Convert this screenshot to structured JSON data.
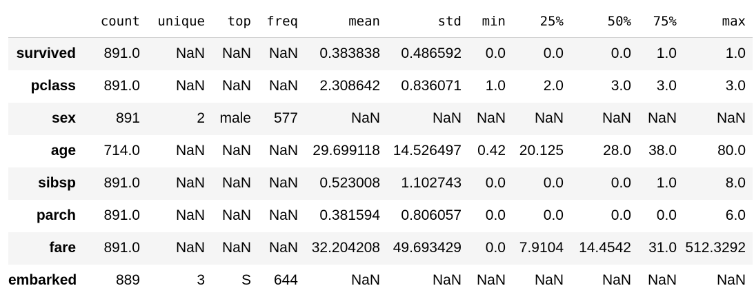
{
  "table": {
    "columns": [
      "count",
      "unique",
      "top",
      "freq",
      "mean",
      "std",
      "min",
      "25%",
      "50%",
      "75%",
      "max"
    ],
    "rows": [
      {
        "label": "survived",
        "cells": [
          "891.0",
          "NaN",
          "NaN",
          "NaN",
          "0.383838",
          "0.486592",
          "0.0",
          "0.0",
          "0.0",
          "1.0",
          "1.0"
        ]
      },
      {
        "label": "pclass",
        "cells": [
          "891.0",
          "NaN",
          "NaN",
          "NaN",
          "2.308642",
          "0.836071",
          "1.0",
          "2.0",
          "3.0",
          "3.0",
          "3.0"
        ]
      },
      {
        "label": "sex",
        "cells": [
          "891",
          "2",
          "male",
          "577",
          "NaN",
          "NaN",
          "NaN",
          "NaN",
          "NaN",
          "NaN",
          "NaN"
        ]
      },
      {
        "label": "age",
        "cells": [
          "714.0",
          "NaN",
          "NaN",
          "NaN",
          "29.699118",
          "14.526497",
          "0.42",
          "20.125",
          "28.0",
          "38.0",
          "80.0"
        ]
      },
      {
        "label": "sibsp",
        "cells": [
          "891.0",
          "NaN",
          "NaN",
          "NaN",
          "0.523008",
          "1.102743",
          "0.0",
          "0.0",
          "0.0",
          "1.0",
          "8.0"
        ]
      },
      {
        "label": "parch",
        "cells": [
          "891.0",
          "NaN",
          "NaN",
          "NaN",
          "0.381594",
          "0.806057",
          "0.0",
          "0.0",
          "0.0",
          "0.0",
          "6.0"
        ]
      },
      {
        "label": "fare",
        "cells": [
          "891.0",
          "NaN",
          "NaN",
          "NaN",
          "32.204208",
          "49.693429",
          "0.0",
          "7.9104",
          "14.4542",
          "31.0",
          "512.3292"
        ]
      },
      {
        "label": "embarked",
        "cells": [
          "889",
          "3",
          "S",
          "644",
          "NaN",
          "NaN",
          "NaN",
          "NaN",
          "NaN",
          "NaN",
          "NaN"
        ]
      }
    ]
  },
  "colors": {
    "stripe": "#f5f5f5",
    "header_border": "#cfcfcf",
    "text": "#000000"
  }
}
